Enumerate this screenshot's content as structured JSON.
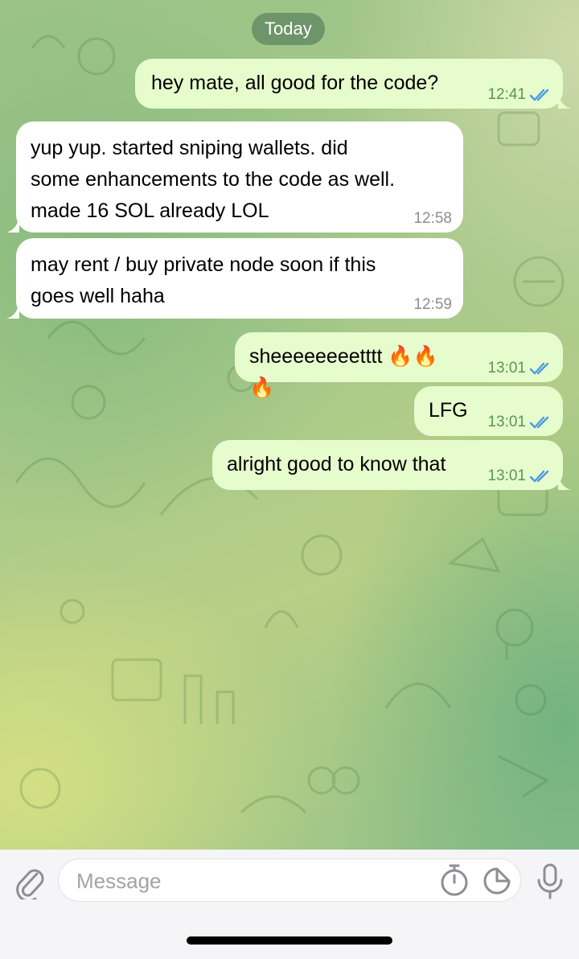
{
  "chat": {
    "date_label": "Today",
    "messages": [
      {
        "direction": "outgoing",
        "text": "hey mate, all good for the code?",
        "time": "12:41",
        "status": "read"
      },
      {
        "direction": "incoming",
        "text": "yup yup. started sniping wallets. did\nsome enhancements to the code as well.\nmade 16 SOL already LOL",
        "time": "12:58"
      },
      {
        "direction": "incoming",
        "text": "may rent / buy private node soon if this\ngoes well haha",
        "time": "12:59"
      },
      {
        "direction": "outgoing",
        "text": "sheeeeeeeetttt 🔥🔥🔥",
        "time": "13:01",
        "status": "read"
      },
      {
        "direction": "outgoing",
        "text": "LFG",
        "time": "13:01",
        "status": "read"
      },
      {
        "direction": "outgoing",
        "text": "alright good to know that",
        "time": "13:01",
        "status": "read"
      }
    ]
  },
  "composer": {
    "placeholder": "Message",
    "value": "",
    "icons": [
      "paperclip-icon",
      "timer-icon",
      "sticker-icon",
      "microphone-icon"
    ]
  },
  "colors": {
    "outgoing_bubble": "#e6fccd",
    "incoming_bubble": "#ffffff",
    "read_check": "#4a9be0",
    "date_chip": "#6a8f67"
  }
}
